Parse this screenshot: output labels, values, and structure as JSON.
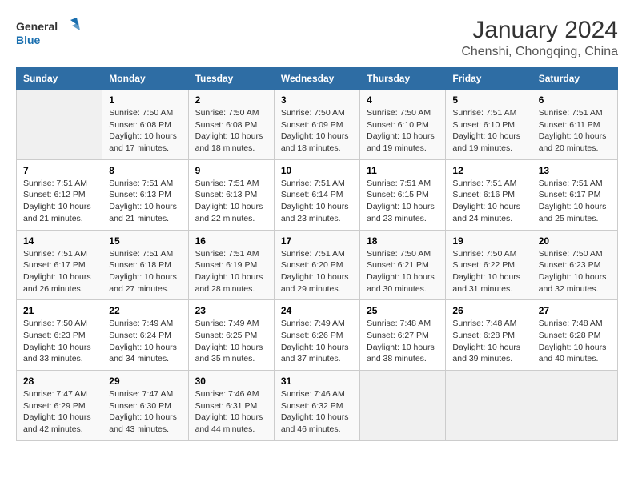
{
  "logo": {
    "line1": "General",
    "line2": "Blue"
  },
  "title": "January 2024",
  "subtitle": "Chenshi, Chongqing, China",
  "days_of_week": [
    "Sunday",
    "Monday",
    "Tuesday",
    "Wednesday",
    "Thursday",
    "Friday",
    "Saturday"
  ],
  "weeks": [
    [
      {
        "day": "",
        "info": ""
      },
      {
        "day": "1",
        "info": "Sunrise: 7:50 AM\nSunset: 6:08 PM\nDaylight: 10 hours\nand 17 minutes."
      },
      {
        "day": "2",
        "info": "Sunrise: 7:50 AM\nSunset: 6:08 PM\nDaylight: 10 hours\nand 18 minutes."
      },
      {
        "day": "3",
        "info": "Sunrise: 7:50 AM\nSunset: 6:09 PM\nDaylight: 10 hours\nand 18 minutes."
      },
      {
        "day": "4",
        "info": "Sunrise: 7:50 AM\nSunset: 6:10 PM\nDaylight: 10 hours\nand 19 minutes."
      },
      {
        "day": "5",
        "info": "Sunrise: 7:51 AM\nSunset: 6:10 PM\nDaylight: 10 hours\nand 19 minutes."
      },
      {
        "day": "6",
        "info": "Sunrise: 7:51 AM\nSunset: 6:11 PM\nDaylight: 10 hours\nand 20 minutes."
      }
    ],
    [
      {
        "day": "7",
        "info": "Sunrise: 7:51 AM\nSunset: 6:12 PM\nDaylight: 10 hours\nand 21 minutes."
      },
      {
        "day": "8",
        "info": "Sunrise: 7:51 AM\nSunset: 6:13 PM\nDaylight: 10 hours\nand 21 minutes."
      },
      {
        "day": "9",
        "info": "Sunrise: 7:51 AM\nSunset: 6:13 PM\nDaylight: 10 hours\nand 22 minutes."
      },
      {
        "day": "10",
        "info": "Sunrise: 7:51 AM\nSunset: 6:14 PM\nDaylight: 10 hours\nand 23 minutes."
      },
      {
        "day": "11",
        "info": "Sunrise: 7:51 AM\nSunset: 6:15 PM\nDaylight: 10 hours\nand 23 minutes."
      },
      {
        "day": "12",
        "info": "Sunrise: 7:51 AM\nSunset: 6:16 PM\nDaylight: 10 hours\nand 24 minutes."
      },
      {
        "day": "13",
        "info": "Sunrise: 7:51 AM\nSunset: 6:17 PM\nDaylight: 10 hours\nand 25 minutes."
      }
    ],
    [
      {
        "day": "14",
        "info": "Sunrise: 7:51 AM\nSunset: 6:17 PM\nDaylight: 10 hours\nand 26 minutes."
      },
      {
        "day": "15",
        "info": "Sunrise: 7:51 AM\nSunset: 6:18 PM\nDaylight: 10 hours\nand 27 minutes."
      },
      {
        "day": "16",
        "info": "Sunrise: 7:51 AM\nSunset: 6:19 PM\nDaylight: 10 hours\nand 28 minutes."
      },
      {
        "day": "17",
        "info": "Sunrise: 7:51 AM\nSunset: 6:20 PM\nDaylight: 10 hours\nand 29 minutes."
      },
      {
        "day": "18",
        "info": "Sunrise: 7:50 AM\nSunset: 6:21 PM\nDaylight: 10 hours\nand 30 minutes."
      },
      {
        "day": "19",
        "info": "Sunrise: 7:50 AM\nSunset: 6:22 PM\nDaylight: 10 hours\nand 31 minutes."
      },
      {
        "day": "20",
        "info": "Sunrise: 7:50 AM\nSunset: 6:23 PM\nDaylight: 10 hours\nand 32 minutes."
      }
    ],
    [
      {
        "day": "21",
        "info": "Sunrise: 7:50 AM\nSunset: 6:23 PM\nDaylight: 10 hours\nand 33 minutes."
      },
      {
        "day": "22",
        "info": "Sunrise: 7:49 AM\nSunset: 6:24 PM\nDaylight: 10 hours\nand 34 minutes."
      },
      {
        "day": "23",
        "info": "Sunrise: 7:49 AM\nSunset: 6:25 PM\nDaylight: 10 hours\nand 35 minutes."
      },
      {
        "day": "24",
        "info": "Sunrise: 7:49 AM\nSunset: 6:26 PM\nDaylight: 10 hours\nand 37 minutes."
      },
      {
        "day": "25",
        "info": "Sunrise: 7:48 AM\nSunset: 6:27 PM\nDaylight: 10 hours\nand 38 minutes."
      },
      {
        "day": "26",
        "info": "Sunrise: 7:48 AM\nSunset: 6:28 PM\nDaylight: 10 hours\nand 39 minutes."
      },
      {
        "day": "27",
        "info": "Sunrise: 7:48 AM\nSunset: 6:28 PM\nDaylight: 10 hours\nand 40 minutes."
      }
    ],
    [
      {
        "day": "28",
        "info": "Sunrise: 7:47 AM\nSunset: 6:29 PM\nDaylight: 10 hours\nand 42 minutes."
      },
      {
        "day": "29",
        "info": "Sunrise: 7:47 AM\nSunset: 6:30 PM\nDaylight: 10 hours\nand 43 minutes."
      },
      {
        "day": "30",
        "info": "Sunrise: 7:46 AM\nSunset: 6:31 PM\nDaylight: 10 hours\nand 44 minutes."
      },
      {
        "day": "31",
        "info": "Sunrise: 7:46 AM\nSunset: 6:32 PM\nDaylight: 10 hours\nand 46 minutes."
      },
      {
        "day": "",
        "info": ""
      },
      {
        "day": "",
        "info": ""
      },
      {
        "day": "",
        "info": ""
      }
    ]
  ]
}
